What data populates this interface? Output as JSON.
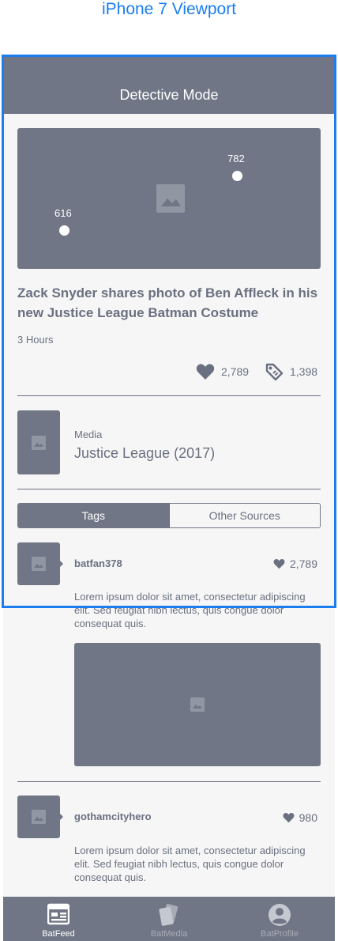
{
  "annotation": {
    "viewport_label": "iPhone 7 Viewport"
  },
  "header": {
    "title": "Detective Mode"
  },
  "hero": {
    "image_icon": "image-placeholder-icon",
    "pins": [
      {
        "label": "616"
      },
      {
        "label": "782"
      }
    ]
  },
  "article": {
    "headline": "Zack Snyder shares photo of Ben Affleck in his new Justice League Batman Costume",
    "time": "3 Hours",
    "likes": "2,789",
    "tags_count": "1,398"
  },
  "media": {
    "category": "Media",
    "title": "Justice League (2017)"
  },
  "tabs": [
    {
      "label": "Tags",
      "active": true
    },
    {
      "label": "Other Sources",
      "active": false
    }
  ],
  "posts": [
    {
      "username": "batfan378",
      "likes": "2,789",
      "text": "Lorem ipsum dolor sit amet, consectetur adipiscing elit. Sed feugiat nibh lectus, quis congue dolor consequat quis."
    },
    {
      "username": "gothamcityhero",
      "likes": "980",
      "text": "Lorem ipsum dolor sit amet, consectetur adipiscing elit. Sed feugiat nibh lectus, quis congue dolor consequat quis."
    }
  ],
  "bottom_nav": [
    {
      "label": "BatFeed",
      "icon": "feed-icon",
      "active": true
    },
    {
      "label": "BatMedia",
      "icon": "media-cards-icon",
      "active": false
    },
    {
      "label": "BatProfile",
      "icon": "profile-icon",
      "active": false
    }
  ],
  "colors": {
    "accent": "#1a7df0",
    "primary_gray": "#707685",
    "text_gray": "#6a7080",
    "background": "#f6f6f6"
  }
}
